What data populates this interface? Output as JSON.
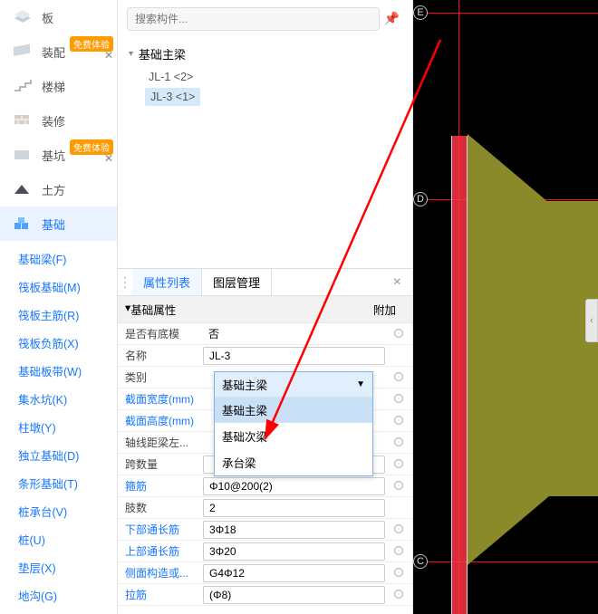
{
  "sidebar": {
    "cats": [
      {
        "label": "板",
        "badge": ""
      },
      {
        "label": "装配",
        "badge": "免费体验",
        "x": "✕"
      },
      {
        "label": "楼梯",
        "badge": ""
      },
      {
        "label": "装修",
        "badge": ""
      },
      {
        "label": "基坑",
        "badge": "免费体验",
        "x": "✕"
      },
      {
        "label": "土方",
        "badge": ""
      },
      {
        "label": "基础",
        "badge": ""
      }
    ],
    "subs": [
      "基础梁(F)",
      "筏板基础(M)",
      "筏板主筋(R)",
      "筏板负筋(X)",
      "基础板带(W)",
      "集水坑(K)",
      "柱墩(Y)",
      "独立基础(D)",
      "条形基础(T)",
      "桩承台(V)",
      "桩(U)",
      "垫层(X)",
      "地沟(G)"
    ]
  },
  "search": {
    "placeholder": "搜索构件..."
  },
  "tree": {
    "parent": "基础主梁",
    "children": [
      "JL-1  <2>",
      "JL-3  <1>"
    ]
  },
  "propPanel": {
    "tabs": [
      "属性列表",
      "图层管理"
    ],
    "section": "基础属性",
    "fj": "附加",
    "rows": [
      {
        "label": "是否有底模",
        "val": "否",
        "input": false,
        "link": false,
        "radio": true
      },
      {
        "label": "名称",
        "val": "JL-3",
        "input": true,
        "link": false,
        "radio": false
      },
      {
        "label": "类别",
        "val": "基础主梁",
        "input": false,
        "link": false,
        "radio": true,
        "combo": true
      },
      {
        "label": "截面宽度(mm)",
        "val": "",
        "input": false,
        "link": true,
        "radio": true
      },
      {
        "label": "截面高度(mm)",
        "val": "",
        "input": false,
        "link": true,
        "radio": true
      },
      {
        "label": "轴线距梁左...",
        "val": "",
        "input": false,
        "link": false,
        "radio": true
      },
      {
        "label": "跨数量",
        "val": "",
        "input": true,
        "link": false,
        "radio": true
      },
      {
        "label": "箍筋",
        "val": "Φ10@200(2)",
        "input": true,
        "link": true,
        "radio": true
      },
      {
        "label": "肢数",
        "val": "2",
        "input": true,
        "link": false,
        "radio": false
      },
      {
        "label": "下部通长筋",
        "val": "3Φ18",
        "input": true,
        "link": true,
        "radio": true
      },
      {
        "label": "上部通长筋",
        "val": "3Φ20",
        "input": true,
        "link": true,
        "radio": true
      },
      {
        "label": "侧面构造或...",
        "val": "G4Φ12",
        "input": true,
        "link": true,
        "radio": true
      },
      {
        "label": "拉筋",
        "val": "(Φ8)",
        "input": true,
        "link": true,
        "radio": true
      }
    ]
  },
  "dropdown": {
    "head": "基础主梁",
    "opts": [
      "基础主梁",
      "基础次梁",
      "承台梁"
    ]
  },
  "canvas": {
    "bubbles": [
      "E",
      "D",
      "C"
    ]
  }
}
